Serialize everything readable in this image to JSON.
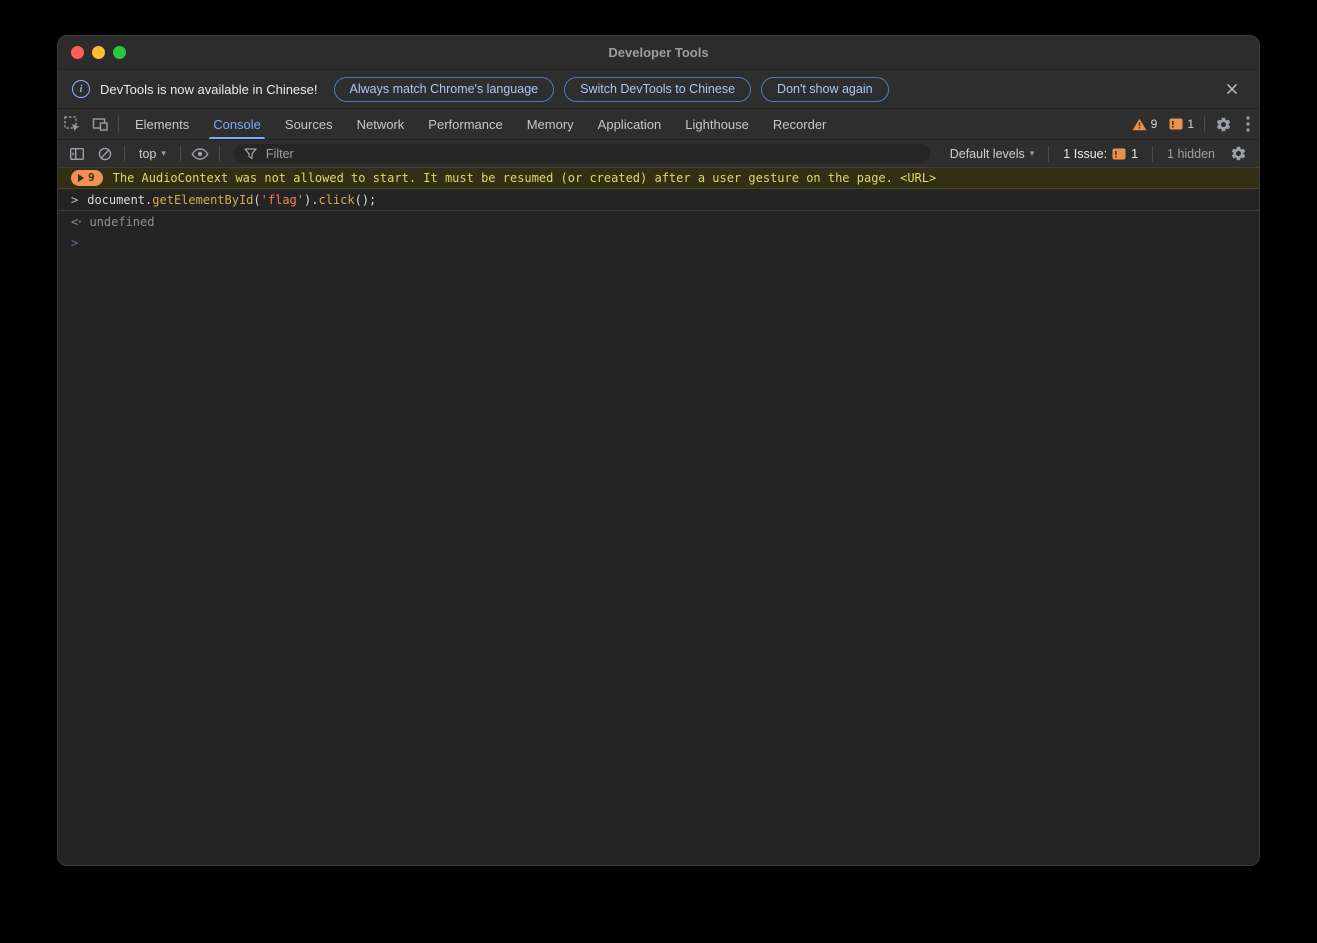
{
  "window": {
    "title": "Developer Tools"
  },
  "banner": {
    "message": "DevTools is now available in Chinese!",
    "buttons": [
      "Always match Chrome's language",
      "Switch DevTools to Chinese",
      "Don't show again"
    ]
  },
  "tabs": {
    "items": [
      "Elements",
      "Console",
      "Sources",
      "Network",
      "Performance",
      "Memory",
      "Application",
      "Lighthouse",
      "Recorder"
    ],
    "active": "Console",
    "warning_count": "9",
    "issue_count": "1"
  },
  "console_toolbar": {
    "context": "top",
    "filter_placeholder": "Filter",
    "levels": "Default levels",
    "issues_label": "1 Issue:",
    "issues_count": "1",
    "hidden_label": "1 hidden"
  },
  "console": {
    "warning_count": "9",
    "warning_message": "The AudioContext was not allowed to start. It must be resumed (or created) after a user gesture on the page. <URL>",
    "command": {
      "t0": "document.",
      "t1": "getElementById",
      "t2": "(",
      "t3": "'flag'",
      "t4": ").",
      "t5": "click",
      "t6": "();"
    },
    "result": "undefined",
    "return_glyph": "<·",
    "prompt_glyph": ">",
    "command_glyph": ">"
  },
  "colors": {
    "accent_blue": "#7cacf8",
    "button_blue": "#a8c7fa",
    "warning_orange": "#ef9058",
    "warning_text": "#e2d66e",
    "console_bg": "#242424"
  }
}
